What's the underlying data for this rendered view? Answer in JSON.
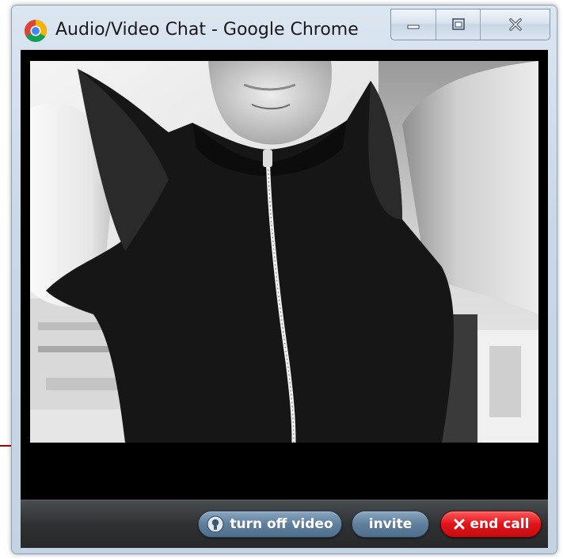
{
  "window": {
    "title": "Audio/Video Chat - Google Chrome",
    "app_icon": "chrome-logo-icon",
    "controls": {
      "minimize_icon": "minimize-icon",
      "maximize_icon": "maximize-icon",
      "close_icon": "close-icon"
    }
  },
  "video": {
    "content": "webcam-video-feed"
  },
  "controls": {
    "turn_off_video_label": "turn off video",
    "invite_label": "invite",
    "end_call_label": "end call"
  },
  "colors": {
    "end_call": "#e0141a",
    "secondary_button": "#5f7f9c",
    "annotation_arrow": "#a00000"
  }
}
